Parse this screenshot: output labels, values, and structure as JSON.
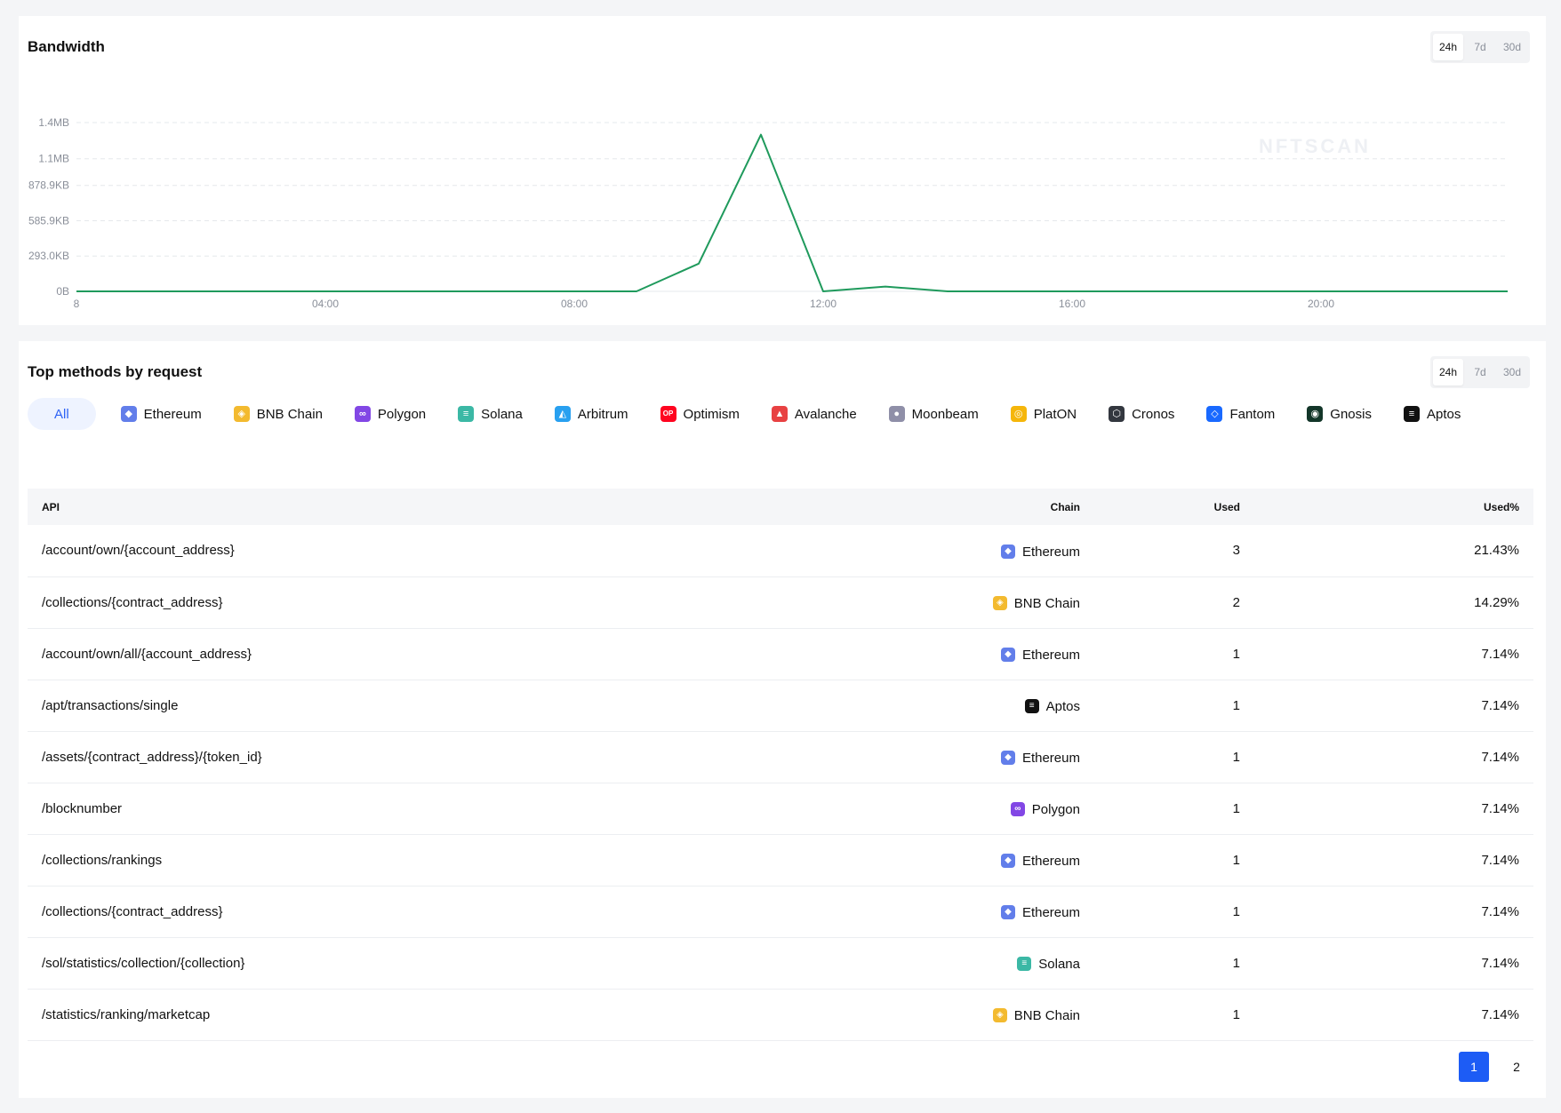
{
  "bandwidth": {
    "title": "Bandwidth",
    "ranges": [
      "24h",
      "7d",
      "30d"
    ],
    "active_range": "24h",
    "watermark": "NFTSCAN"
  },
  "chart_data": {
    "type": "line",
    "title": "Bandwidth",
    "x": [
      0,
      1,
      2,
      3,
      4,
      5,
      6,
      7,
      8,
      9,
      10,
      11,
      12,
      13,
      14,
      15,
      16,
      17,
      18,
      19,
      20,
      21,
      22,
      23
    ],
    "x_tick_values": [
      0,
      4,
      8,
      12,
      16,
      20
    ],
    "x_tick_labels": [
      "8",
      "04:00",
      "08:00",
      "12:00",
      "16:00",
      "20:00"
    ],
    "y_tick_values": [
      0,
      293000,
      585900,
      878900,
      1100000,
      1400000
    ],
    "y_tick_labels": [
      "0B",
      "293.0KB",
      "585.9KB",
      "878.9KB",
      "1.1MB",
      "1.4MB"
    ],
    "ylim": [
      0,
      1400000
    ],
    "series": [
      {
        "values": [
          0,
          0,
          0,
          0,
          0,
          0,
          0,
          0,
          0,
          0,
          230000,
          1300000,
          0,
          40000,
          0,
          0,
          0,
          0,
          0,
          0,
          0,
          0,
          0,
          0
        ]
      }
    ],
    "line_color": "#1f9a5c",
    "grid": true
  },
  "methods": {
    "title": "Top methods by request",
    "ranges": [
      "24h",
      "7d",
      "30d"
    ],
    "active_range": "24h",
    "filters": [
      {
        "label": "All",
        "icon": "",
        "color": ""
      },
      {
        "label": "Ethereum",
        "icon": "ethereum-icon",
        "color": "#627eea",
        "glyph": "◆"
      },
      {
        "label": "BNB Chain",
        "icon": "bnb-chain-icon",
        "color": "#f3ba2f",
        "glyph": "◈"
      },
      {
        "label": "Polygon",
        "icon": "polygon-icon",
        "color": "#8247e5",
        "glyph": "∞"
      },
      {
        "label": "Solana",
        "icon": "solana-icon",
        "color": "#3bb8a5",
        "glyph": "≡"
      },
      {
        "label": "Arbitrum",
        "icon": "arbitrum-icon",
        "color": "#28a0f0",
        "glyph": "◭"
      },
      {
        "label": "Optimism",
        "icon": "optimism-icon",
        "color": "#ff0420",
        "glyph": "OP"
      },
      {
        "label": "Avalanche",
        "icon": "avalanche-icon",
        "color": "#e84142",
        "glyph": "▲"
      },
      {
        "label": "Moonbeam",
        "icon": "moonbeam-icon",
        "color": "#8f8fa8",
        "glyph": "●"
      },
      {
        "label": "PlatON",
        "icon": "platon-icon",
        "color": "#f5b60b",
        "glyph": "◎"
      },
      {
        "label": "Cronos",
        "icon": "cronos-icon",
        "color": "#33373f",
        "glyph": "⬡"
      },
      {
        "label": "Fantom",
        "icon": "fantom-icon",
        "color": "#1969ff",
        "glyph": "◇"
      },
      {
        "label": "Gnosis",
        "icon": "gnosis-icon",
        "color": "#133629",
        "glyph": "◉"
      },
      {
        "label": "Aptos",
        "icon": "aptos-icon",
        "color": "#111111",
        "glyph": "≡"
      }
    ],
    "columns": {
      "api": "API",
      "chain": "Chain",
      "used": "Used",
      "used_pct": "Used%"
    },
    "rows": [
      {
        "api": "/account/own/{account_address}",
        "chain": "Ethereum",
        "used": "3",
        "used_pct": "21.43%"
      },
      {
        "api": "/collections/{contract_address}",
        "chain": "BNB Chain",
        "used": "2",
        "used_pct": "14.29%"
      },
      {
        "api": "/account/own/all/{account_address}",
        "chain": "Ethereum",
        "used": "1",
        "used_pct": "7.14%"
      },
      {
        "api": "/apt/transactions/single",
        "chain": "Aptos",
        "used": "1",
        "used_pct": "7.14%"
      },
      {
        "api": "/assets/{contract_address}/{token_id}",
        "chain": "Ethereum",
        "used": "1",
        "used_pct": "7.14%"
      },
      {
        "api": "/blocknumber",
        "chain": "Polygon",
        "used": "1",
        "used_pct": "7.14%"
      },
      {
        "api": "/collections/rankings",
        "chain": "Ethereum",
        "used": "1",
        "used_pct": "7.14%"
      },
      {
        "api": "/collections/{contract_address}",
        "chain": "Ethereum",
        "used": "1",
        "used_pct": "7.14%"
      },
      {
        "api": "/sol/statistics/collection/{collection}",
        "chain": "Solana",
        "used": "1",
        "used_pct": "7.14%"
      },
      {
        "api": "/statistics/ranking/marketcap",
        "chain": "BNB Chain",
        "used": "1",
        "used_pct": "7.14%"
      }
    ],
    "pages": [
      "1",
      "2"
    ],
    "active_page": "1"
  }
}
